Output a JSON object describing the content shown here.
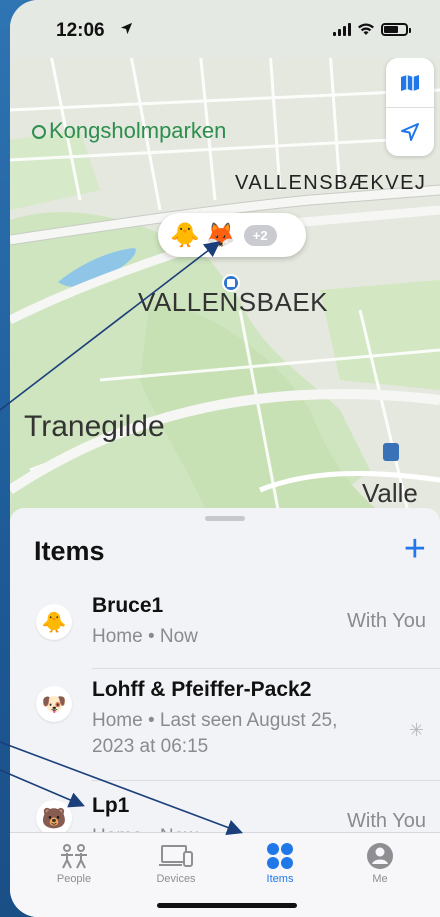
{
  "status_bar": {
    "time": "12:06",
    "location_icon": "location-arrow-icon",
    "signal_icon": "cellular-signal-icon",
    "wifi_icon": "wifi-icon",
    "battery_icon": "battery-icon"
  },
  "map": {
    "labels": {
      "park": "Kongsholmparken",
      "road": "VALLENSBÆKVEJ",
      "town": "VALLENSBAEK",
      "district": "Tranegilde",
      "partial": "Valle"
    },
    "cluster": {
      "emojis": [
        "🐥",
        "🦊"
      ],
      "more": "+2"
    }
  },
  "sheet": {
    "title": "Items",
    "items": [
      {
        "emoji": "🐥",
        "name": "Bruce1",
        "sub": "Home • Now",
        "status": "With You"
      },
      {
        "emoji": "🐶",
        "name": "Lohff & Pfeiffer-Pack2",
        "sub": "Home • Last seen August 25, 2023 at 06:15",
        "status": ""
      },
      {
        "emoji": "🐻",
        "name": "Lp1",
        "sub": "Home • Now",
        "status": "With You"
      }
    ]
  },
  "tabbar": {
    "tabs": [
      {
        "label": "People",
        "icon": "people-icon"
      },
      {
        "label": "Devices",
        "icon": "devices-icon"
      },
      {
        "label": "Items",
        "icon": "items-icon",
        "active": true
      },
      {
        "label": "Me",
        "icon": "me-icon"
      }
    ]
  },
  "colors": {
    "accent": "#1f77e8",
    "background": "#2f74b3",
    "park_green": "#2d8f4e"
  }
}
